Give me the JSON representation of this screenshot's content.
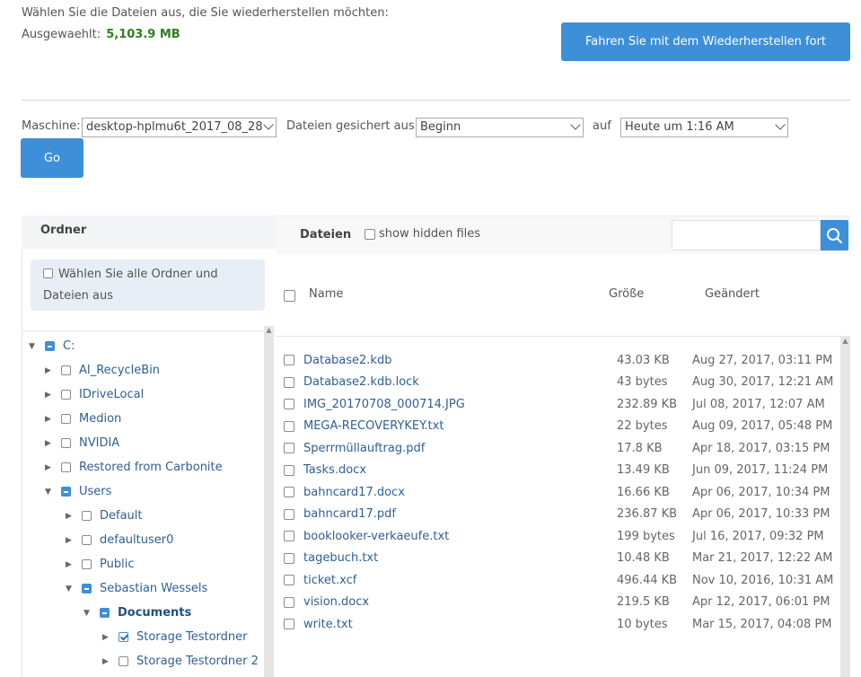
{
  "header": {
    "instruction": "Wählen Sie die Dateien aus, die Sie wiederherstellen möchten:",
    "selected_label": "Ausgewaehlt:",
    "selected_value": "5,103.9 MB",
    "continue_label": "Fahren Sie mit dem Wiederherstellen fort"
  },
  "filters": {
    "machine_label": "Maschine:",
    "machine_value": "desktop-hplmu6t_2017_08_28",
    "backed_up_label": "Dateien gesichert aus:",
    "backed_up_value": "Beginn",
    "to_label": "auf",
    "to_value": "Heute um 1:16 AM",
    "go_label": "Go"
  },
  "folders": {
    "title": "Ordner",
    "select_all_label": "Wählen Sie alle Ordner und Dateien aus",
    "tree": [
      {
        "label": "C:",
        "level": 0,
        "expanded": true,
        "state": "partial"
      },
      {
        "label": "AI_RecycleBin",
        "level": 1,
        "expanded": false,
        "state": "none"
      },
      {
        "label": "IDriveLocal",
        "level": 1,
        "expanded": false,
        "state": "none"
      },
      {
        "label": "Medion",
        "level": 1,
        "expanded": false,
        "state": "none"
      },
      {
        "label": "NVIDIA",
        "level": 1,
        "expanded": false,
        "state": "none"
      },
      {
        "label": "Restored from Carbonite",
        "level": 1,
        "expanded": false,
        "state": "none"
      },
      {
        "label": "Users",
        "level": 1,
        "expanded": true,
        "state": "partial"
      },
      {
        "label": "Default",
        "level": 2,
        "expanded": false,
        "state": "none"
      },
      {
        "label": "defaultuser0",
        "level": 2,
        "expanded": false,
        "state": "none"
      },
      {
        "label": "Public",
        "level": 2,
        "expanded": false,
        "state": "none"
      },
      {
        "label": "Sebastian Wessels",
        "level": 2,
        "expanded": true,
        "state": "partial"
      },
      {
        "label": "Documents",
        "level": 3,
        "expanded": true,
        "state": "partial",
        "bold": true
      },
      {
        "label": "Storage Testordner",
        "level": 4,
        "expanded": false,
        "state": "checked"
      },
      {
        "label": "Storage Testordner 2",
        "level": 4,
        "expanded": false,
        "state": "none"
      }
    ]
  },
  "files": {
    "title": "Dateien",
    "show_hidden_label": "show hidden files",
    "columns": {
      "name": "Name",
      "size": "Größe",
      "modified": "Geändert"
    },
    "rows": [
      {
        "name": "Database2.kdb",
        "size": "43.03 KB",
        "modified": "Aug 27, 2017, 03:11 PM"
      },
      {
        "name": "Database2.kdb.lock",
        "size": "43 bytes",
        "modified": "Aug 30, 2017, 12:21 AM"
      },
      {
        "name": "IMG_20170708_000714.JPG",
        "size": "232.89 KB",
        "modified": "Jul 08, 2017, 12:07 AM"
      },
      {
        "name": "MEGA-RECOVERYKEY.txt",
        "size": "22 bytes",
        "modified": "Aug 09, 2017, 05:48 PM"
      },
      {
        "name": "Sperrmüllauftrag.pdf",
        "size": "17.8 KB",
        "modified": "Apr 18, 2017, 03:15 PM"
      },
      {
        "name": "Tasks.docx",
        "size": "13.49 KB",
        "modified": "Jun 09, 2017, 11:24 PM"
      },
      {
        "name": "bahncard17.docx",
        "size": "16.66 KB",
        "modified": "Apr 06, 2017, 10:34 PM"
      },
      {
        "name": "bahncard17.pdf",
        "size": "236.87 KB",
        "modified": "Apr 06, 2017, 10:33 PM"
      },
      {
        "name": "booklooker-verkaeufe.txt",
        "size": "199 bytes",
        "modified": "Jul 16, 2017, 09:32 PM"
      },
      {
        "name": "tagebuch.txt",
        "size": "10.48 KB",
        "modified": "Mar 21, 2017, 12:22 AM"
      },
      {
        "name": "ticket.xcf",
        "size": "496.44 KB",
        "modified": "Nov 10, 2016, 10:31 AM"
      },
      {
        "name": "vision.docx",
        "size": "219.5 KB",
        "modified": "Apr 12, 2017, 06:01 PM"
      },
      {
        "name": "write.txt",
        "size": "10 bytes",
        "modified": "Mar 15, 2017, 04:08 PM"
      }
    ]
  }
}
